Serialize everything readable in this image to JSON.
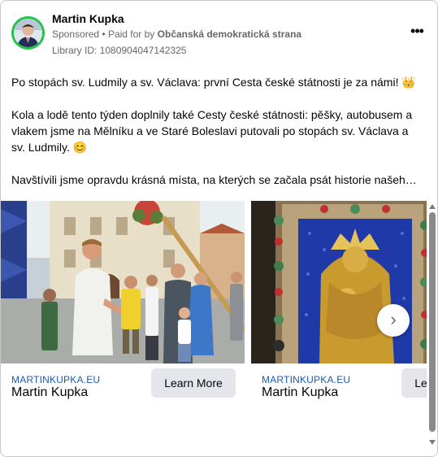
{
  "post": {
    "author": "Martin Kupka",
    "sponsored_label": "Sponsored",
    "paid_for_prefix": "Paid for by",
    "paid_for_by": "Občanská demokratická strana",
    "library_id": "Library ID: 1080904047142325",
    "more_icon": "more-horizontal-icon",
    "body_paragraphs": [
      "Po stopách sv. Ludmily a sv. Václava: první Cesta české státnosti je za námi! 👑",
      "Kola a lodě tento týden doplnily také Cesty české státnosti: pěšky, autobusem a vlakem jsme na Mělníku a ve Staré Boleslavi putovali po stopách sv. Václava a sv. Ludmily. 😊",
      "Navštívili jsme opravdu krásná místa, na kterých se začala psát historie našeho…"
    ]
  },
  "carousel": {
    "cards": [
      {
        "domain": "MARTINKUPKA.EU",
        "title": "Martin Kupka",
        "cta": "Learn More"
      },
      {
        "domain": "MARTINKUPKA.EU",
        "title": "Martin Kupka",
        "cta": "Learn More"
      }
    ],
    "next_icon": "chevron-right-icon",
    "next_glyph": "›"
  },
  "colors": {
    "avatar_ring": "#23c24a",
    "link_domain": "#1b5bb8",
    "muted_text": "#65676b",
    "button_bg": "#e4e6eb"
  }
}
